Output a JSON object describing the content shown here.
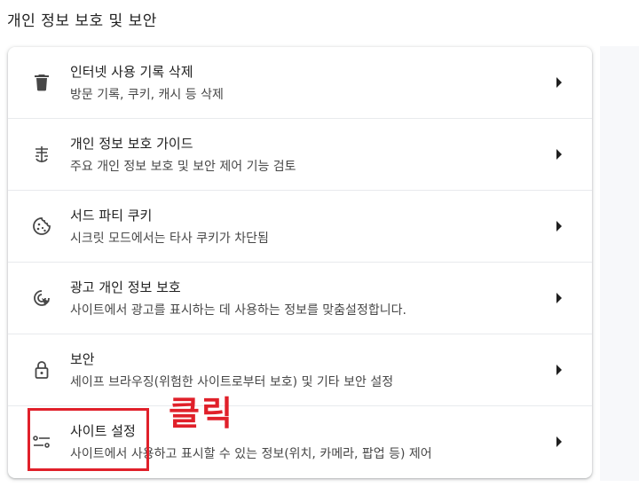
{
  "section": {
    "title": "개인 정보 보호 및 보안"
  },
  "items": [
    {
      "icon": "trash-icon",
      "title": "인터넷 사용 기록 삭제",
      "description": "방문 기록, 쿠키, 캐시 등 삭제"
    },
    {
      "icon": "privacy-guide-icon",
      "title": "개인 정보 보호 가이드",
      "description": "주요 개인 정보 보호 및 보안 제어 기능 검토"
    },
    {
      "icon": "cookie-icon",
      "title": "서드 파티 쿠키",
      "description": "시크릿 모드에서는 타사 쿠키가 차단됨"
    },
    {
      "icon": "ad-privacy-icon",
      "title": "광고 개인 정보 보호",
      "description": "사이트에서 광고를 표시하는 데 사용하는 정보를 맞춤설정합니다."
    },
    {
      "icon": "lock-icon",
      "title": "보안",
      "description": "세이프 브라우징(위험한 사이트로부터 보호) 및 기타 보안 설정"
    },
    {
      "icon": "site-settings-icon",
      "title": "사이트 설정",
      "description": "사이트에서 사용하고 표시할 수 있는 정보(위치, 카메라, 팝업 등) 제어"
    }
  ],
  "annotation": {
    "text": "클릭",
    "color": "#e0202a"
  },
  "colors": {
    "text_primary": "#1f1f1f",
    "text_secondary": "#474747",
    "divider": "#e8eaed"
  }
}
